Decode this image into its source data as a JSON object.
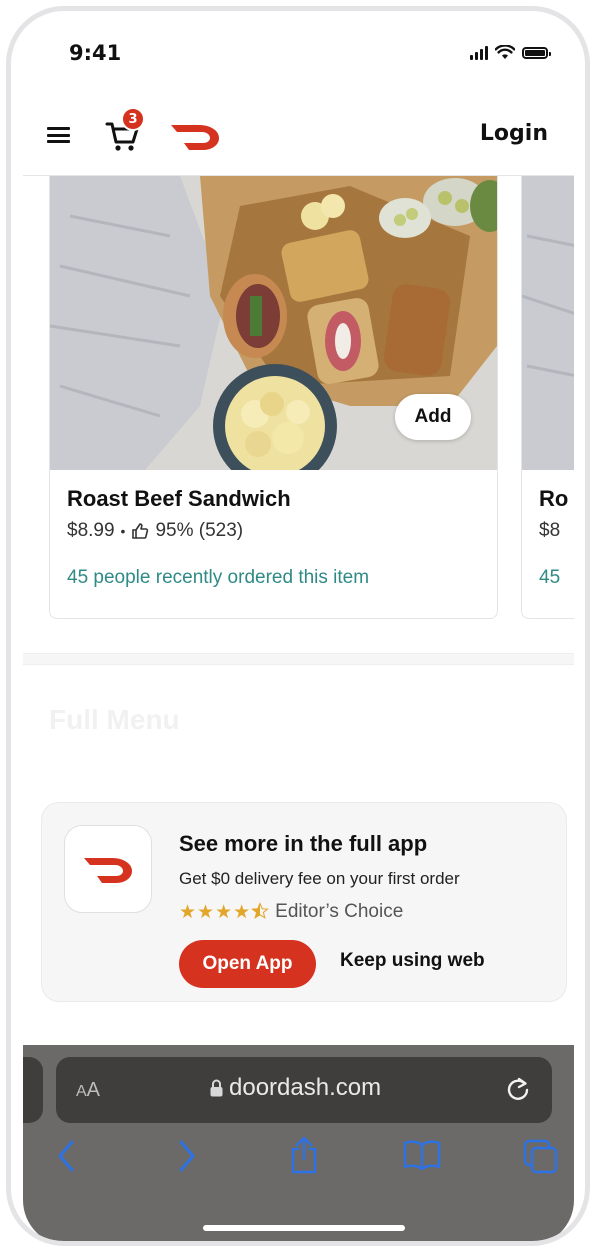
{
  "status_bar": {
    "time": "9:41"
  },
  "header": {
    "cart_count": "3",
    "login_label": "Login"
  },
  "featured_item": {
    "add_label": "Add",
    "title": "Roast Beef Sandwich",
    "price": "$8.99",
    "separator": "•",
    "rating": "95% (523)",
    "social_proof": "45 people recently ordered this item"
  },
  "peek_item": {
    "title": "Ro",
    "price": "$8",
    "social_proof": "45"
  },
  "menu_heading": "Full Menu",
  "app_banner": {
    "title": "See more in the full app",
    "subtitle": "Get $0 delivery fee on your first order",
    "stars": "★★★★",
    "rating_label": "Editor’s Choice",
    "open_label": "Open App",
    "keep_label": "Keep using web"
  },
  "browser": {
    "aa_small": "A",
    "aa_big": "A",
    "url": "doordash.com"
  },
  "colors": {
    "brand": "#d5321f",
    "social_proof": "#2f8a86",
    "star": "#e2a62b"
  }
}
